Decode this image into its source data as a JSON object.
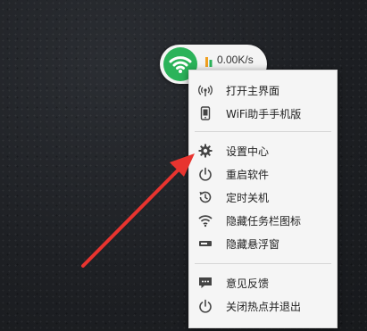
{
  "widget": {
    "speed": "0.00K/s"
  },
  "menu": {
    "items": [
      {
        "label": "打开主界面",
        "icon": "wifi-signal-icon"
      },
      {
        "label": "WiFi助手手机版",
        "icon": "phone-icon"
      },
      {
        "label": "设置中心",
        "icon": "gear-icon"
      },
      {
        "label": "重启软件",
        "icon": "power-icon"
      },
      {
        "label": "定时关机",
        "icon": "clock-history-icon"
      },
      {
        "label": "隐藏任务栏图标",
        "icon": "wifi-icon"
      },
      {
        "label": "隐藏悬浮窗",
        "icon": "window-bar-icon"
      },
      {
        "label": "意见反馈",
        "icon": "chat-icon"
      },
      {
        "label": "关闭热点并退出",
        "icon": "power-icon"
      }
    ]
  },
  "colors": {
    "accent_green": "#2bb35a",
    "arrow_red": "#e8342f",
    "menu_bg": "#f5f5f5"
  }
}
